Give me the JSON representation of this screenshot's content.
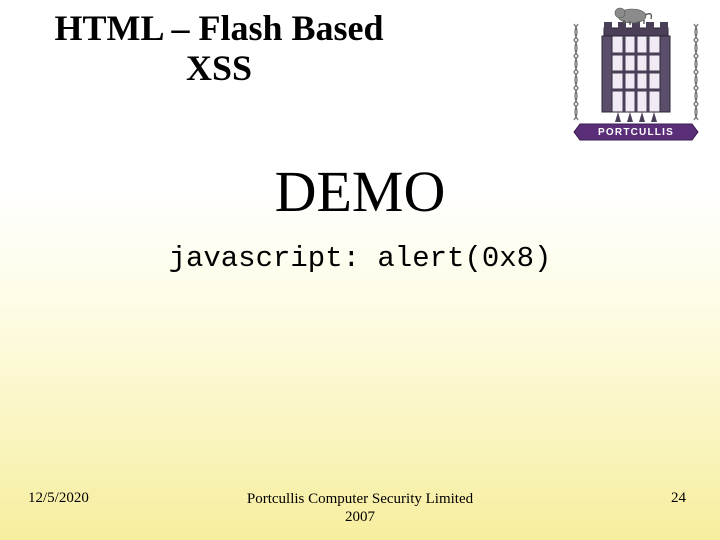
{
  "title_line1": "HTML – Flash Based",
  "title_line2": "XSS",
  "demo_heading": "DEMO",
  "code_line": "javascript: alert(0x8)",
  "footer": {
    "date": "12/5/2020",
    "org_line1": "Portcullis Computer Security Limited",
    "org_line2": "2007",
    "page": "24"
  },
  "logo": {
    "brand_text": "PORTCULLIS"
  }
}
